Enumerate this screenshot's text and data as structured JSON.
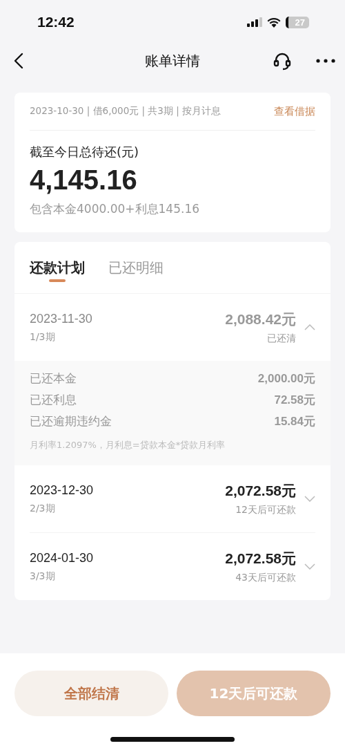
{
  "status_bar": {
    "time": "12:42",
    "battery": "27"
  },
  "nav": {
    "title": "账单详情"
  },
  "summary": {
    "meta": "2023-10-30 | 借6,000元 | 共3期 | 按月计息",
    "link": "查看借据",
    "label": "截至今日总待还(元)",
    "amount": "4,145.16",
    "breakdown": "包含本金4000.00+利息145.16"
  },
  "tabs": [
    {
      "label": "还款计划",
      "selected": true
    },
    {
      "label": "已还明细",
      "selected": false
    }
  ],
  "installments": [
    {
      "date": "2023-11-30",
      "period": "1/3期",
      "amount": "2,088.42元",
      "status": "已还清",
      "settled": true,
      "expanded": true,
      "details": [
        {
          "label": "已还本金",
          "value": "2,000.00元"
        },
        {
          "label": "已还利息",
          "value": "72.58元"
        },
        {
          "label": "已还逾期违约金",
          "value": "15.84元"
        }
      ],
      "note": "月利率1.2097%，月利息=贷款本金*贷款月利率"
    },
    {
      "date": "2023-12-30",
      "period": "2/3期",
      "amount": "2,072.58元",
      "status": "12天后可还款",
      "settled": false,
      "expanded": false
    },
    {
      "date": "2024-01-30",
      "period": "3/3期",
      "amount": "2,072.58元",
      "status": "43天后可还款",
      "settled": false,
      "expanded": false
    }
  ],
  "buttons": [
    {
      "label": "全部结清",
      "kind": "secondary",
      "disabled": false
    },
    {
      "label": "12天后可还款",
      "kind": "primary",
      "disabled": true
    }
  ]
}
